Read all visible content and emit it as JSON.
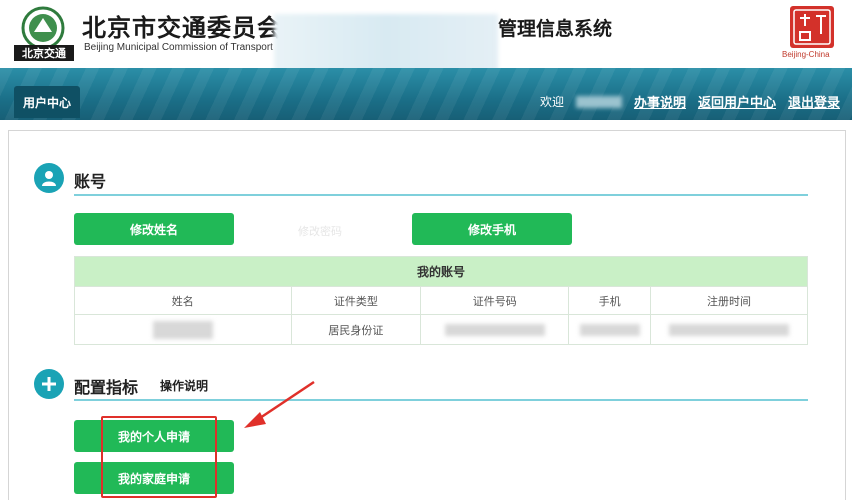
{
  "header": {
    "org_name_cn": "北京市交通委员会",
    "org_name_en": "Beijing Municipal Commission of Transport",
    "logo_mark": "北京交通",
    "system_title": "管理信息系统",
    "seal_text": "Beijing-China"
  },
  "nav": {
    "tab": "用户中心",
    "welcome": "欢迎",
    "links": [
      "办事说明",
      "返回用户中心",
      "退出登录"
    ]
  },
  "account": {
    "section_title": "账号",
    "btn_edit_name": "修改姓名",
    "faded_label": "修改密码",
    "btn_edit_phone": "修改手机",
    "table_title": "我的账号",
    "columns": [
      "姓名",
      "证件类型",
      "证件号码",
      "手机",
      "注册时间"
    ],
    "row": {
      "id_type": "居民身份证"
    }
  },
  "config": {
    "section_title": "配置指标",
    "help_link": "操作说明",
    "btn_personal": "我的个人申请",
    "btn_family": "我的家庭申请"
  },
  "colors": {
    "nav_bg": "#1b6f88",
    "button_green": "#21b957",
    "section_icon": "#1aa3b5",
    "highlight_red": "#e0302a"
  }
}
